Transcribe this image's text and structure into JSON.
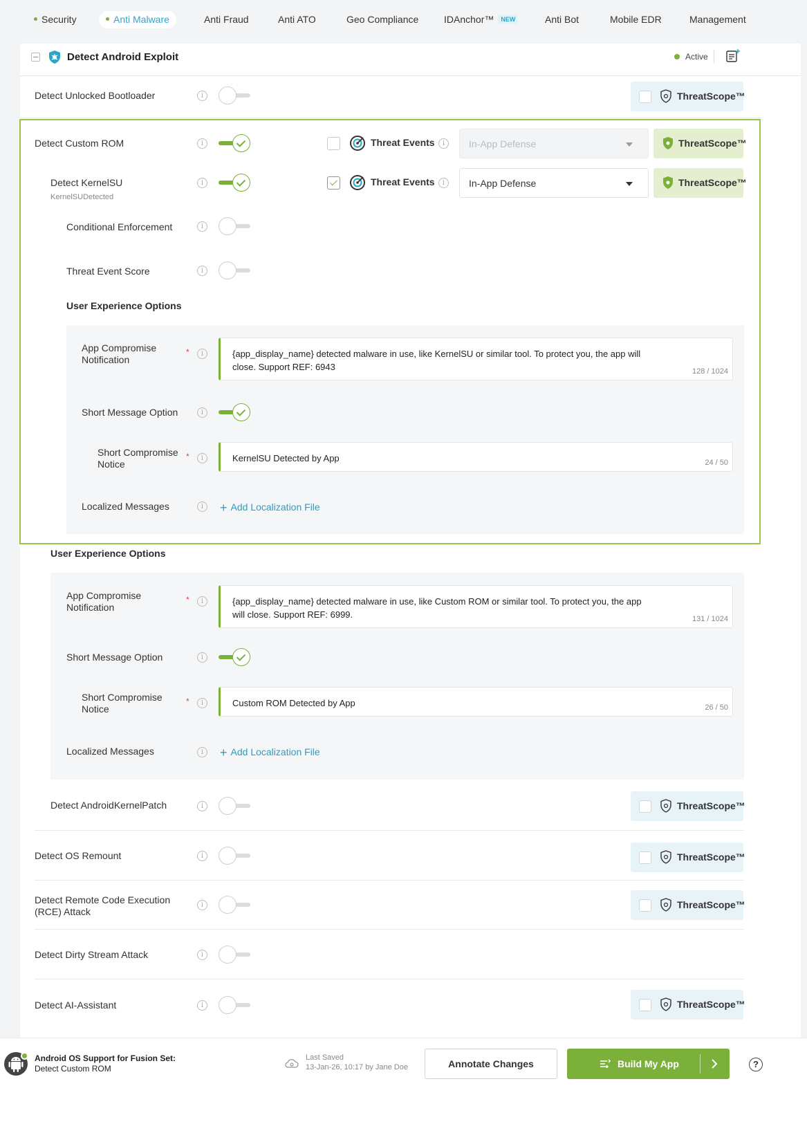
{
  "nav": {
    "items": [
      {
        "label": "Security",
        "dot": true
      },
      {
        "label": "Anti Malware",
        "dot": true,
        "active": true
      },
      {
        "label": "Anti Fraud"
      },
      {
        "label": "Anti ATO"
      },
      {
        "label": "Geo Compliance"
      },
      {
        "label": "IDAnchor™",
        "badge": "NEW"
      },
      {
        "label": "Anti Bot"
      },
      {
        "label": "Mobile EDR"
      },
      {
        "label": "Management"
      }
    ]
  },
  "card": {
    "title": "Detect Android Exploit",
    "status": "Active",
    "status_color": "#7bb13a"
  },
  "threatscope_label": "ThreatScope™",
  "threat_events_label": "Threat Events",
  "rows": {
    "unlocked_bootloader": {
      "label": "Detect Unlocked Bootloader",
      "enabled": false
    },
    "custom_rom": {
      "label": "Detect Custom ROM",
      "enabled": true,
      "threat_events_checked": false,
      "response": "In-App Defense"
    },
    "kernelsu": {
      "label": "Detect KernelSU",
      "sublabel": "KernelSUDetected",
      "enabled": true,
      "threat_events_checked": true,
      "response": "In-App Defense"
    },
    "conditional_enforcement": {
      "label": "Conditional Enforcement",
      "enabled": false
    },
    "threat_event_score": {
      "label": "Threat Event Score",
      "enabled": false
    },
    "android_kernel_patch": {
      "label": "Detect AndroidKernelPatch",
      "enabled": false
    },
    "os_remount": {
      "label": "Detect OS Remount",
      "enabled": false
    },
    "rce": {
      "label": "Detect Remote Code Execution (RCE) Attack",
      "enabled": false
    },
    "dirty_stream": {
      "label": "Detect Dirty Stream Attack",
      "enabled": false
    },
    "ai_assistant": {
      "label": "Detect AI-Assistant",
      "enabled": false
    }
  },
  "ux_kernelsu": {
    "heading": "User Experience Options",
    "app_compromise_label": "App Compromise Notification",
    "app_compromise_text": "{app_display_name} detected malware in use, like KernelSU or similar tool. To protect you, the app will close. Support REF: 6943",
    "app_compromise_count": "128 / 1024",
    "short_message_label": "Short Message Option",
    "short_message_enabled": true,
    "short_notice_label": "Short Compromise Notice",
    "short_notice_text": "KernelSU Detected by App",
    "short_notice_count": "24 / 50",
    "localized_label": "Localized Messages",
    "add_localization": "Add Localization File"
  },
  "ux_custom_rom": {
    "heading": "User Experience Options",
    "app_compromise_label": "App Compromise Notification",
    "app_compromise_text": "{app_display_name} detected malware in use, like Custom ROM or similar tool. To protect you, the app will close. Support REF: 6999.",
    "app_compromise_count": "131 / 1024",
    "short_message_label": "Short Message Option",
    "short_message_enabled": true,
    "short_notice_label": "Short Compromise Notice",
    "short_notice_text": "Custom ROM Detected by App",
    "short_notice_count": "26 / 50",
    "localized_label": "Localized Messages",
    "add_localization": "Add Localization File"
  },
  "footer": {
    "title": "Android OS Support for Fusion Set:",
    "subtitle": "Detect Custom ROM",
    "last_saved_label": "Last Saved",
    "last_saved_value": "13-Jan-26, 10:17 by Jane Doe",
    "annotate_label": "Annotate Changes",
    "build_label": "Build My App",
    "help_label": "?"
  },
  "colors": {
    "accent_green": "#7bb13a",
    "accent_blue": "#2f9bc4"
  }
}
